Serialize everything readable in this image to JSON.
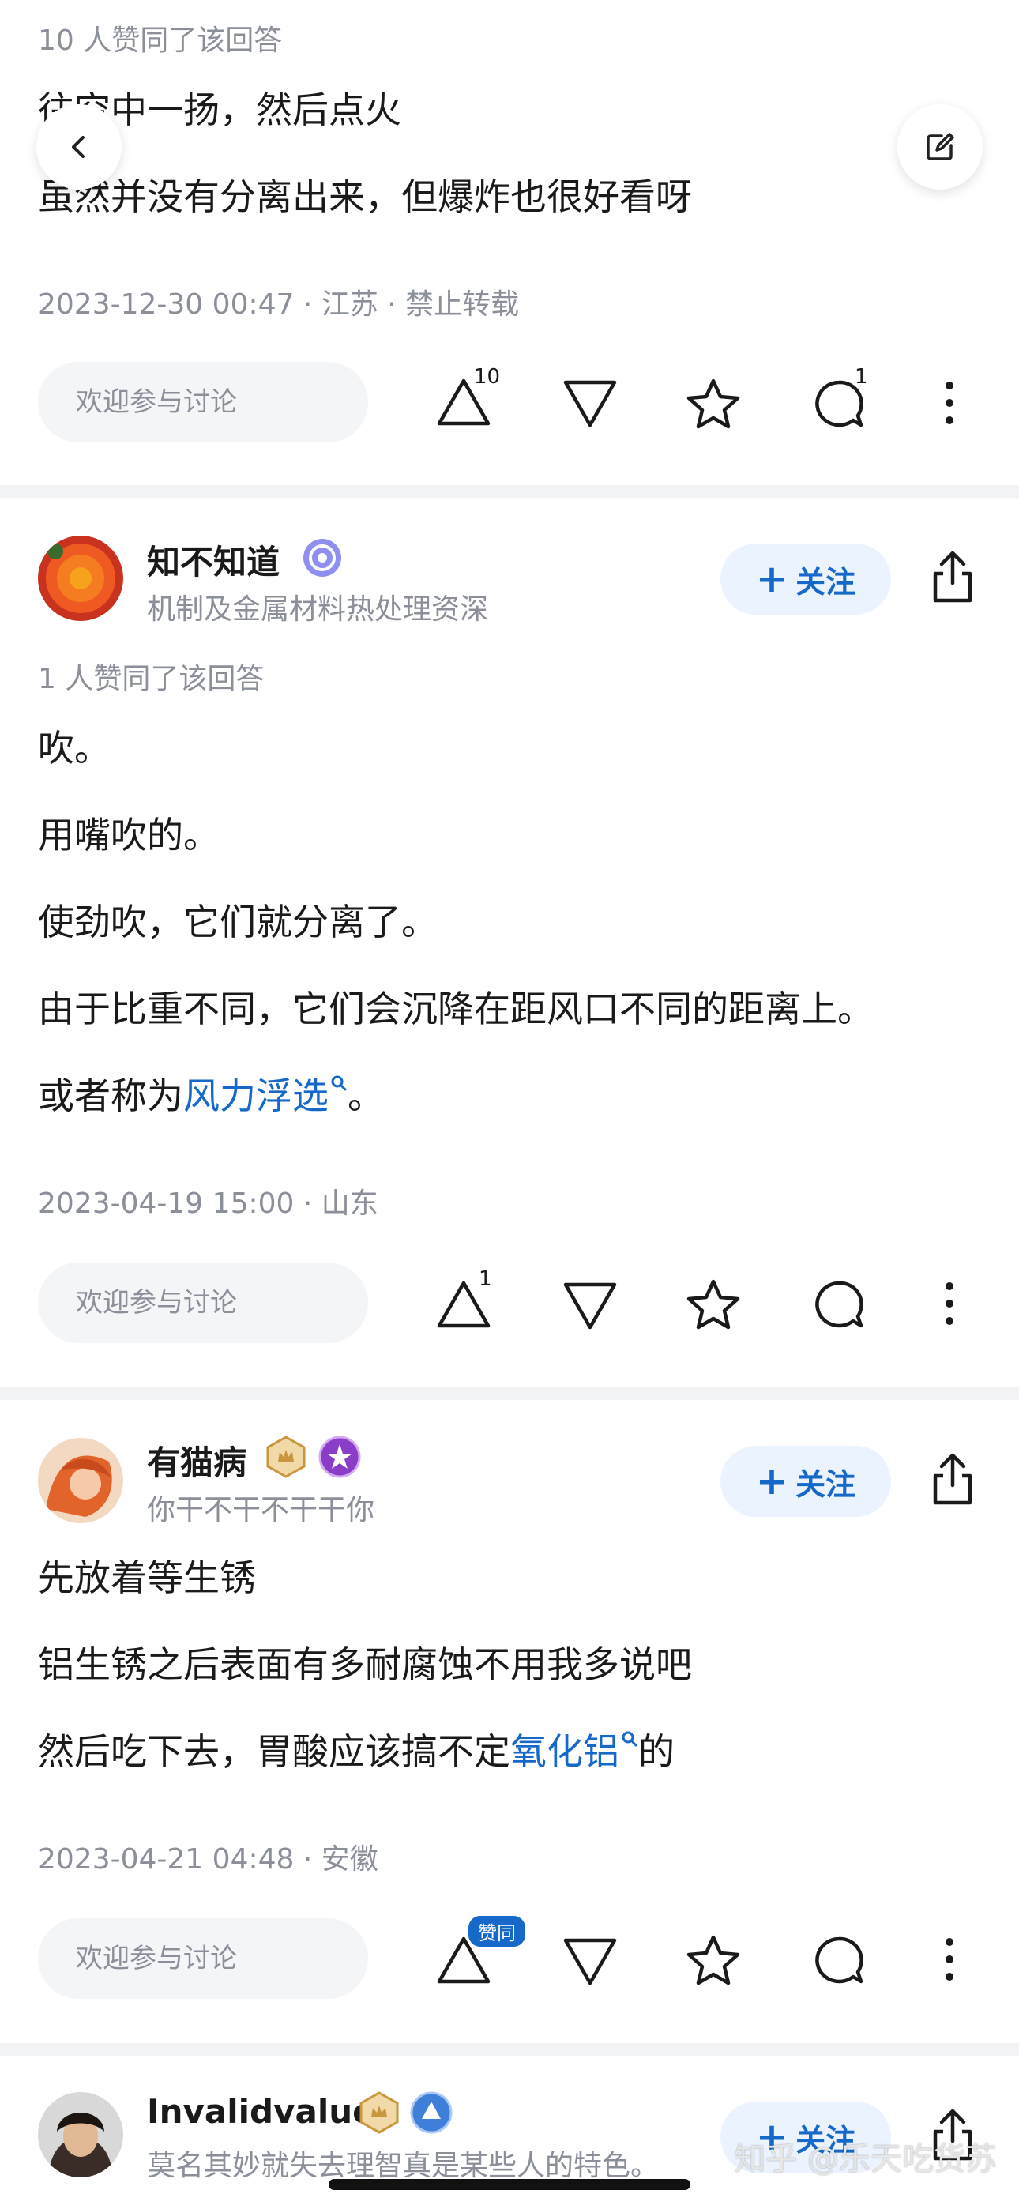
{
  "post1": {
    "likes_text": "10 人赞同了该回答",
    "lines": [
      "往空中一扬，然后点火",
      "虽然并没有分离出来，但爆炸也很好看呀"
    ],
    "meta": "2023-12-30 00:47 · 江苏 · 禁止转载",
    "comment_placeholder": "欢迎参与讨论",
    "upvote_count": "10",
    "comment_count": "1"
  },
  "post2": {
    "author": "知不知道",
    "bio": "机制及金属材料热处理资深",
    "follow_label": "关注",
    "likes_text": "1 人赞同了该回答",
    "line1": "吹。",
    "line2": "用嘴吹的。",
    "line3": "使劲吹，它们就分离了。",
    "line4": "由于比重不同，它们会沉降在距风口不同的距离上。",
    "line5_prefix": "或者称为",
    "line5_link": "风力浮选",
    "line5_suffix": "。",
    "meta": "2023-04-19 15:00 · 山东",
    "comment_placeholder": "欢迎参与讨论",
    "upvote_count": "1"
  },
  "post3": {
    "author": "有猫病",
    "bio": "你干不干不干干你",
    "follow_label": "关注",
    "line1": "先放着等生锈",
    "line2": "铝生锈之后表面有多耐腐蚀不用我多说吧",
    "line3_prefix": "然后吃下去，胃酸应该搞不定",
    "line3_link": "氧化铝",
    "line3_suffix": "的",
    "meta": "2023-04-21 04:48 · 安徽",
    "comment_placeholder": "欢迎参与讨论",
    "agree_badge": "赞同"
  },
  "post4": {
    "author": "Invalidvalue",
    "bio": "莫名其妙就失去理智真是某些人的特色。",
    "follow_label": "关注"
  },
  "watermark": "知乎 @乐天吃货苏",
  "colors": {
    "accent": "#1668c9",
    "follow_bg": "#ebf3ff",
    "divider": "#f2f3f5"
  }
}
